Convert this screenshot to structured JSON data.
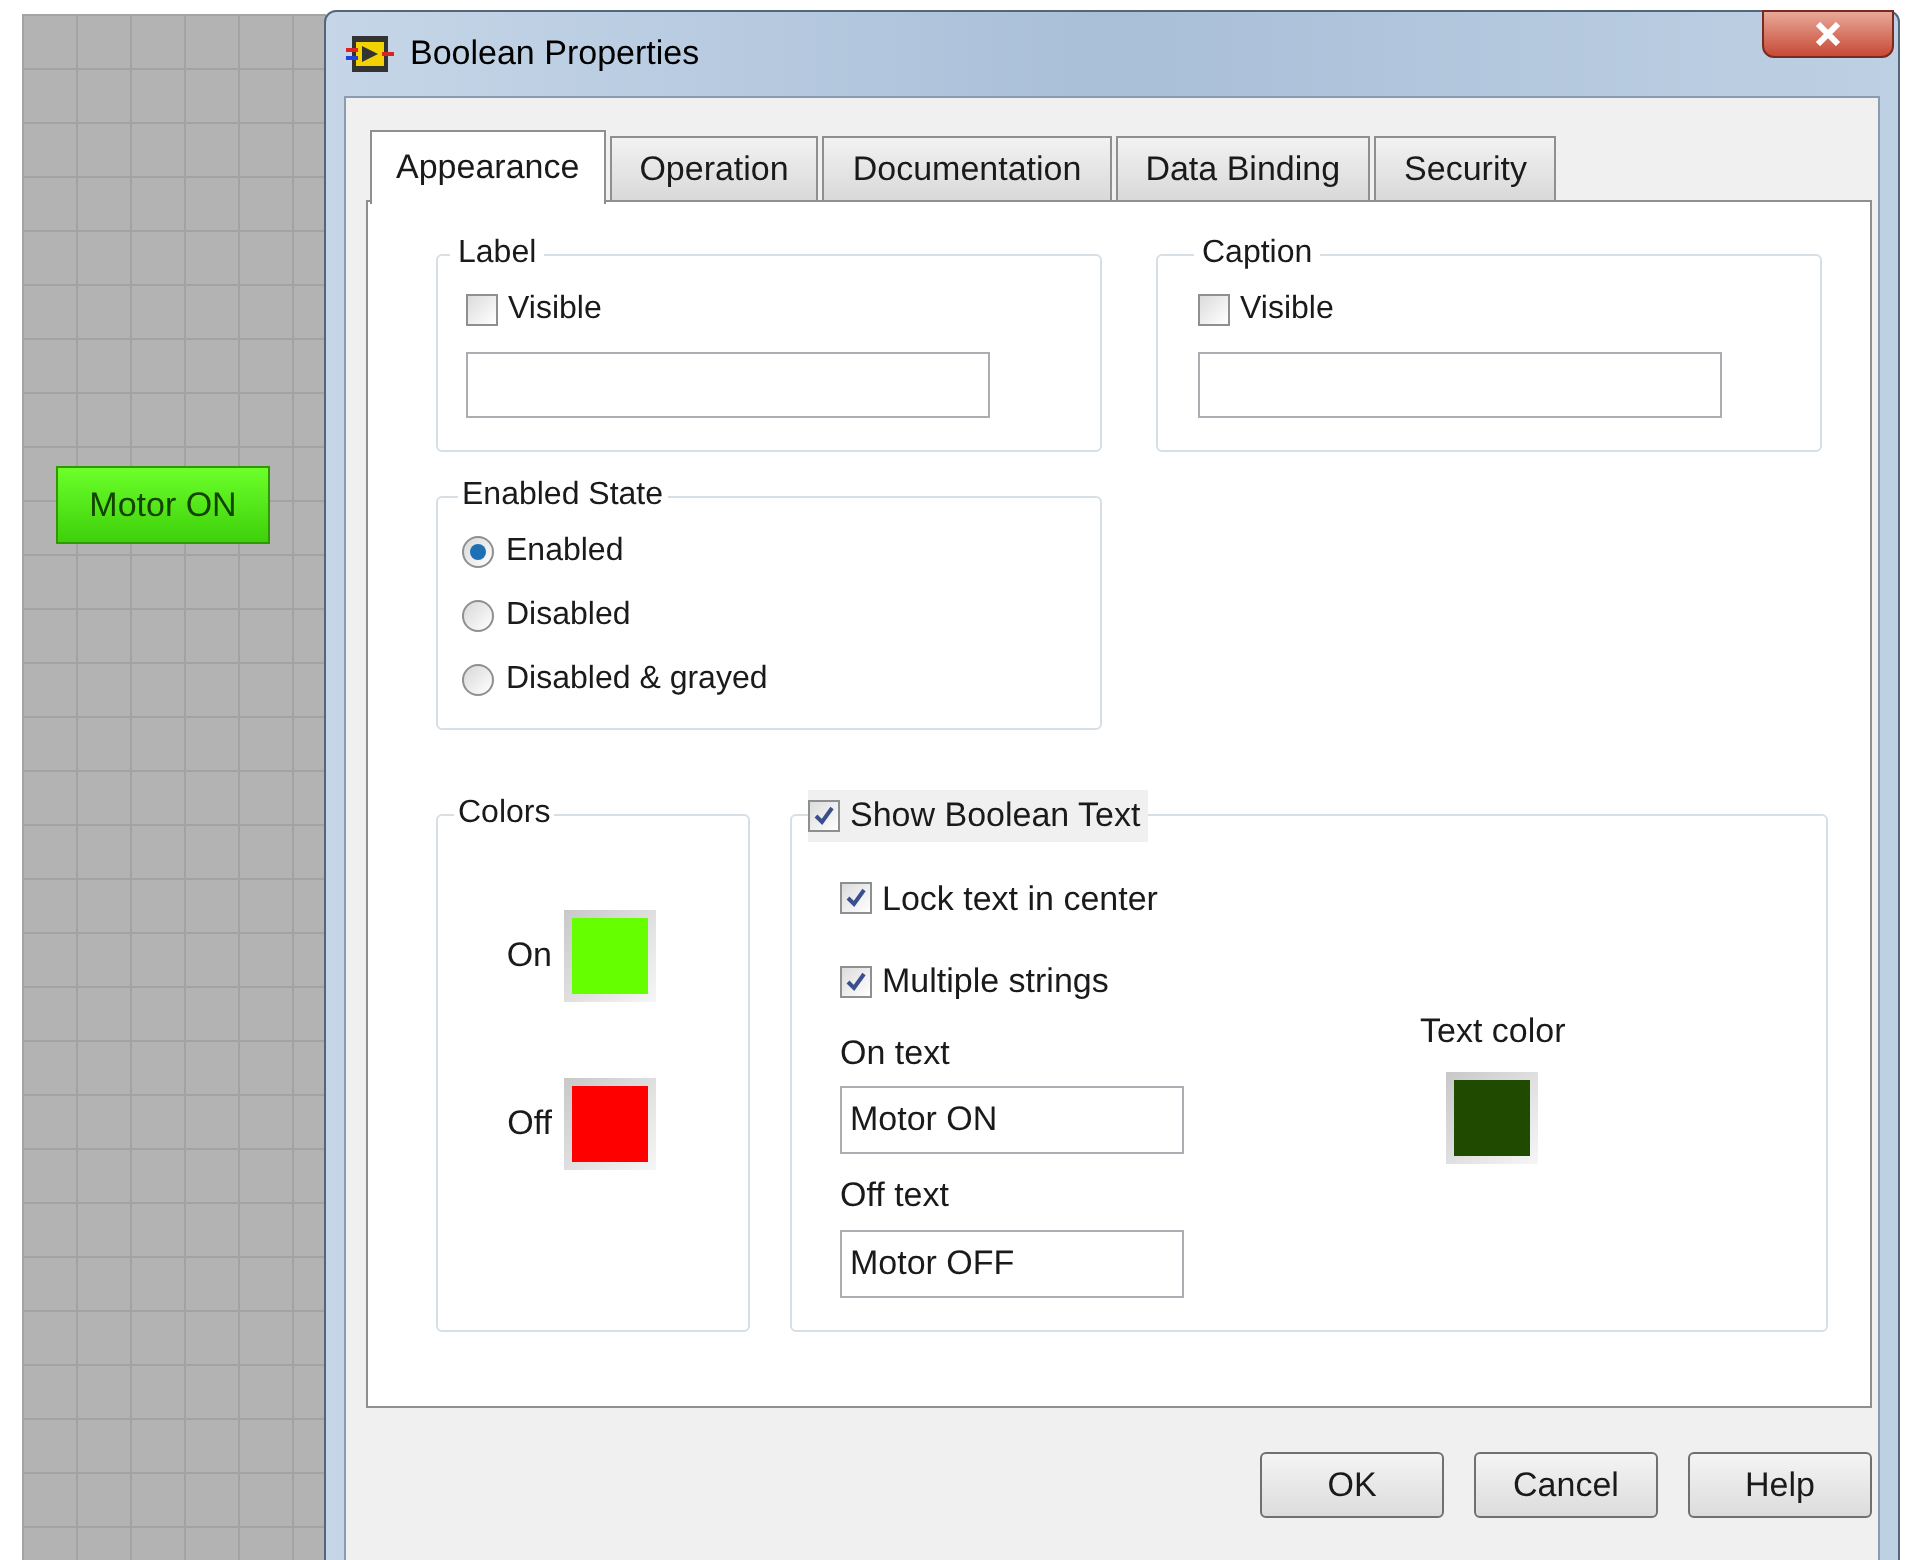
{
  "canvas": {
    "control": {
      "text": "Motor ON"
    }
  },
  "window": {
    "title": "Boolean Properties"
  },
  "tabs": [
    {
      "label": "Appearance",
      "selected": true
    },
    {
      "label": "Operation",
      "selected": false
    },
    {
      "label": "Documentation",
      "selected": false
    },
    {
      "label": "Data Binding",
      "selected": false
    },
    {
      "label": "Security",
      "selected": false
    }
  ],
  "label_group": {
    "title": "Label",
    "checkbox": {
      "label": "Visible",
      "checked": false
    }
  },
  "caption_group": {
    "title": "Caption",
    "checkbox": {
      "label": "Visible",
      "checked": false
    }
  },
  "enabled_state": {
    "title": "Enabled State",
    "options": [
      {
        "label": "Enabled",
        "selected": true
      },
      {
        "label": "Disabled",
        "selected": false
      },
      {
        "label": "Disabled & grayed",
        "selected": false
      }
    ]
  },
  "colors": {
    "title": "Colors",
    "items": [
      {
        "label": "On",
        "color": "#66ff00"
      },
      {
        "label": "Off",
        "color": "#ff0000"
      }
    ]
  },
  "boolean_text": {
    "title": "Show Boolean Text",
    "checked": true,
    "options": [
      {
        "label": "Lock text in center",
        "checked": true
      },
      {
        "label": "Multiple strings",
        "checked": true
      }
    ],
    "fields": [
      {
        "label": "On text",
        "value": "Motor ON"
      },
      {
        "label": "Off text",
        "value": "Motor OFF"
      }
    ],
    "text_color": {
      "label": "Text color",
      "color": "#1f4a00"
    }
  },
  "buttons": [
    "OK",
    "Cancel",
    "Help"
  ]
}
